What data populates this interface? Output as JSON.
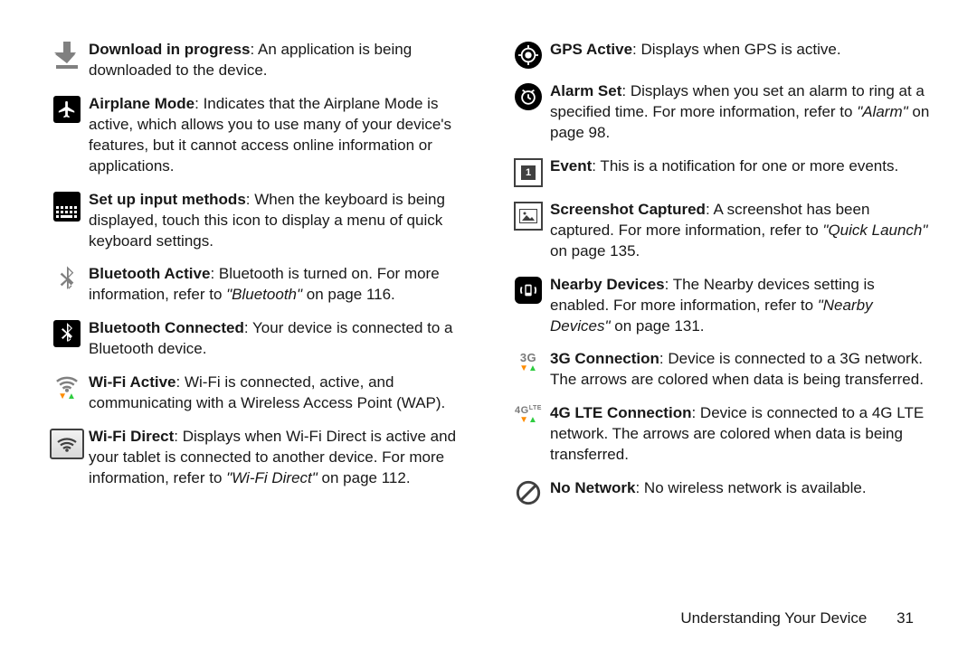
{
  "left": [
    {
      "icon": "download-progress-icon",
      "b": "Download in progress",
      "t": ": An application is being downloaded to the device."
    },
    {
      "icon": "airplane-mode-icon",
      "b": "Airplane Mode",
      "t": ": Indicates that the Airplane Mode is active, which allows you to use many of your device's features, but it cannot access online information or applications."
    },
    {
      "icon": "keyboard-icon",
      "b": "Set up input methods",
      "t": ": When the keyboard is being displayed, touch this icon to display a menu of quick keyboard settings."
    },
    {
      "icon": "bluetooth-active-icon",
      "b": "Bluetooth Active",
      "t": ": Bluetooth is turned on. For more information, refer to ",
      "ref": "\"Bluetooth\"",
      "pg": "on page 116."
    },
    {
      "icon": "bluetooth-connected-icon",
      "b": "Bluetooth Connected",
      "t": ": Your device is connected to a Bluetooth device."
    },
    {
      "icon": "wifi-active-icon",
      "b": "Wi-Fi Active",
      "t": ": Wi-Fi is connected, active, and communicating with a Wireless Access Point (WAP)."
    },
    {
      "icon": "wifi-direct-icon",
      "b": "Wi-Fi Direct",
      "t": ": Displays when Wi-Fi Direct is active and your tablet is connected to another device. For more information, refer to ",
      "ref": "\"Wi-Fi Direct\"",
      "pg": "on page 112."
    }
  ],
  "right": [
    {
      "icon": "gps-active-icon",
      "b": "GPS Active",
      "t": ": Displays when GPS is active."
    },
    {
      "icon": "alarm-set-icon",
      "b": "Alarm Set",
      "t": ": Displays when you set an alarm to ring at a specified time. For more information, refer to ",
      "ref": "\"Alarm\"",
      "pg": "on page 98."
    },
    {
      "icon": "event-icon",
      "b": "Event",
      "t": ": This is a notification for one or more events."
    },
    {
      "icon": "screenshot-captured-icon",
      "b": "Screenshot Captured",
      "t": ": A screenshot has been captured. For more information, refer to ",
      "ref": "\"Quick Launch\"",
      "pg": "on page 135."
    },
    {
      "icon": "nearby-devices-icon",
      "b": "Nearby Devices",
      "t": ": The Nearby devices setting is enabled. For more information, refer to ",
      "ref": "\"Nearby Devices\"",
      "pg": "on page 131."
    },
    {
      "icon": "3g-connection-icon",
      "b": "3G Connection",
      "t": ": Device is connected to a 3G network. The arrows are colored when data is being transferred."
    },
    {
      "icon": "4g-lte-connection-icon",
      "b": "4G LTE Connection",
      "t": ": Device is connected to a 4G LTE network. The arrows are colored when data is being transferred."
    },
    {
      "icon": "no-network-icon",
      "b": "No Network",
      "t": ": No wireless network is available."
    }
  ],
  "footer": {
    "section": "Understanding Your Device",
    "page": "31"
  }
}
